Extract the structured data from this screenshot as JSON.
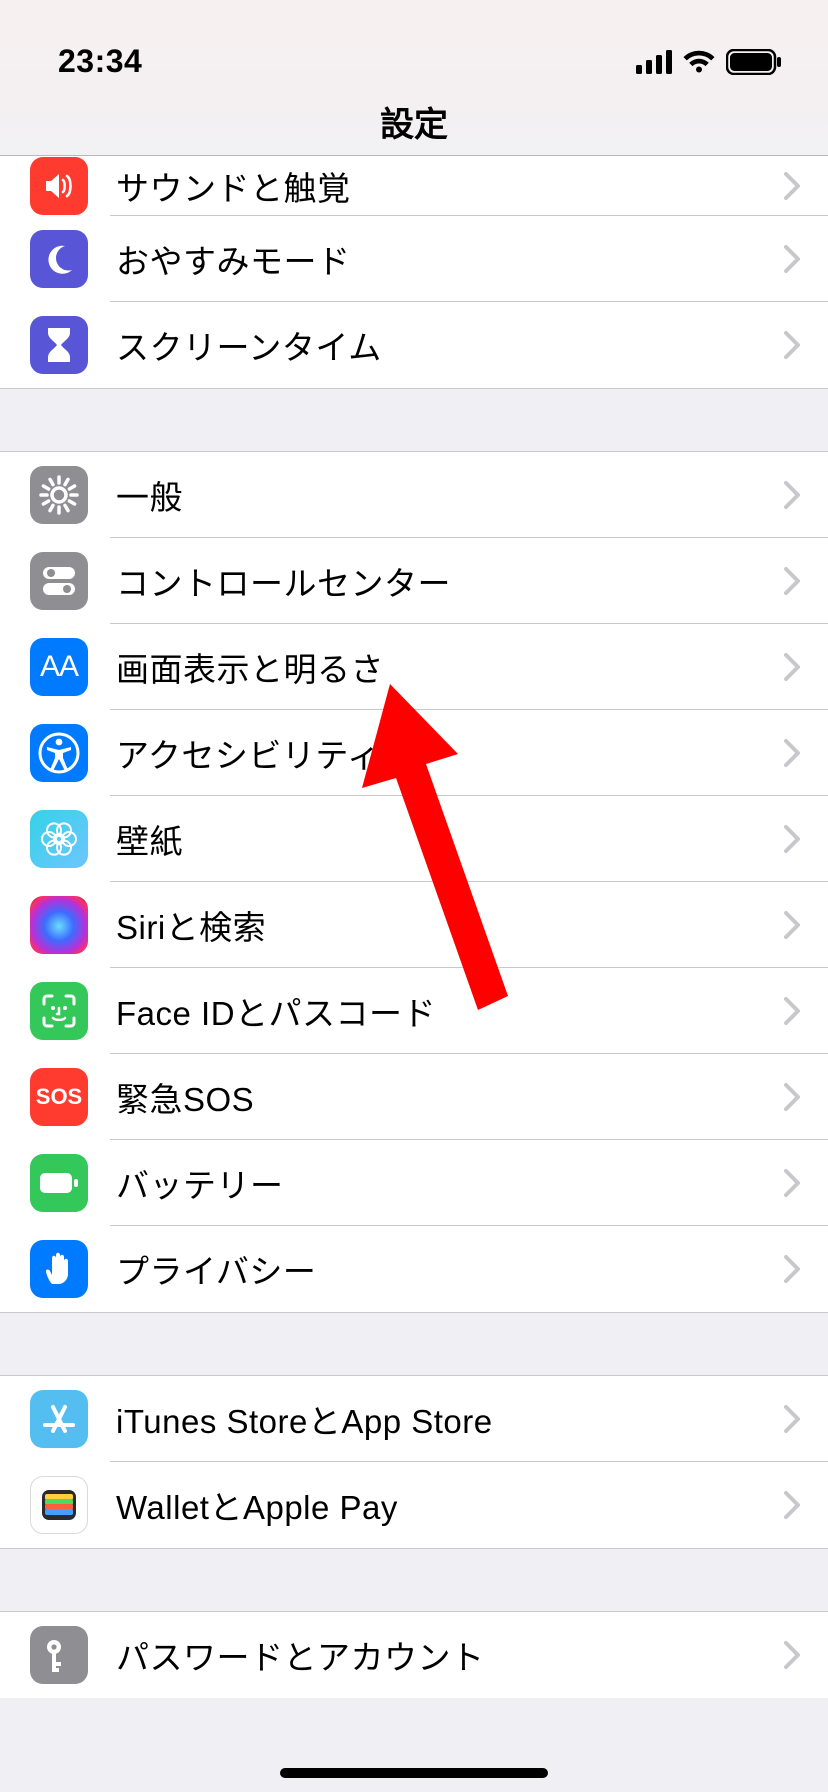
{
  "status_bar": {
    "time": "23:34"
  },
  "header": {
    "title": "設定"
  },
  "groups": [
    {
      "id": "g1",
      "cutoff_top": true,
      "items": [
        {
          "id": "sounds",
          "label": "サウンドと触覚",
          "icon": "speaker",
          "short_top": true
        },
        {
          "id": "dnd",
          "label": "おやすみモード",
          "icon": "moon"
        },
        {
          "id": "screentime",
          "label": "スクリーンタイム",
          "icon": "hourglass"
        }
      ]
    },
    {
      "id": "g2",
      "items": [
        {
          "id": "general",
          "label": "一般",
          "icon": "gear"
        },
        {
          "id": "controlcenter",
          "label": "コントロールセンター",
          "icon": "toggles"
        },
        {
          "id": "display",
          "label": "画面表示と明るさ",
          "icon": "aa"
        },
        {
          "id": "accessibility",
          "label": "アクセシビリティ",
          "icon": "accessibility"
        },
        {
          "id": "wallpaper",
          "label": "壁紙",
          "icon": "flower"
        },
        {
          "id": "siri",
          "label": "Siriと検索",
          "icon": "siri"
        },
        {
          "id": "faceid",
          "label": "Face IDとパスコード",
          "icon": "face"
        },
        {
          "id": "sos",
          "label": "緊急SOS",
          "icon": "sos"
        },
        {
          "id": "battery",
          "label": "バッテリー",
          "icon": "battery"
        },
        {
          "id": "privacy",
          "label": "プライバシー",
          "icon": "hand"
        }
      ]
    },
    {
      "id": "g3",
      "items": [
        {
          "id": "itunes",
          "label": "iTunes StoreとApp Store",
          "icon": "appstore"
        },
        {
          "id": "wallet",
          "label": "WalletとApple Pay",
          "icon": "wallet"
        }
      ]
    },
    {
      "id": "g4",
      "cutoff_bottom": true,
      "items": [
        {
          "id": "passwords",
          "label": "パスワードとアカウント",
          "icon": "key"
        }
      ]
    }
  ],
  "annotation": {
    "arrow_points_to": "accessibility"
  }
}
